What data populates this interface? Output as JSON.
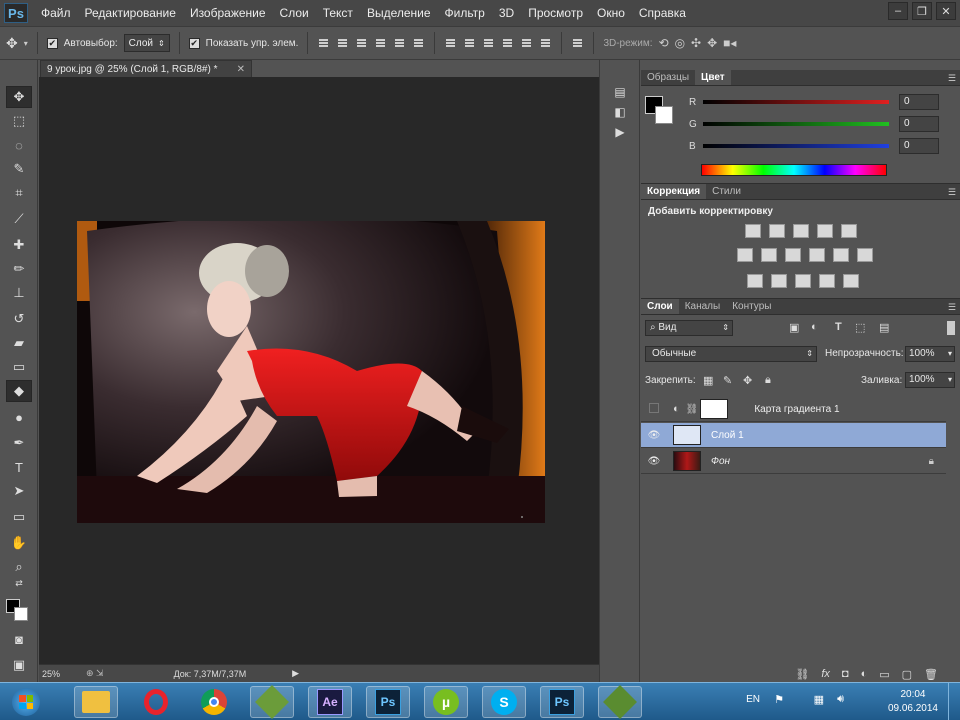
{
  "app": {
    "logo": "Ps"
  },
  "menu": [
    "Файл",
    "Редактирование",
    "Изображение",
    "Слои",
    "Текст",
    "Выделение",
    "Фильтр",
    "3D",
    "Просмотр",
    "Окно",
    "Справка"
  ],
  "options": {
    "autoselect_label": "Автовыбор:",
    "autoselect_value": "Слой",
    "show_controls_label": "Показать упр. элем.",
    "mode3d_label": "3D-режим:"
  },
  "document": {
    "tab_title": "9 урок.jpg @ 25% (Слой 1, RGB/8#) *",
    "zoom": "25%",
    "doc_size": "Док: 7,37M/7,37M"
  },
  "color_panel": {
    "tabs": [
      "Образцы",
      "Цвет"
    ],
    "active_tab": "Цвет",
    "channels": [
      {
        "label": "R",
        "value": "0",
        "color": "#e02020"
      },
      {
        "label": "G",
        "value": "0",
        "color": "#20c020"
      },
      {
        "label": "B",
        "value": "0",
        "color": "#2040e0"
      }
    ]
  },
  "adjust_panel": {
    "tabs": [
      "Коррекция",
      "Стили"
    ],
    "active_tab": "Коррекция",
    "title": "Добавить корректировку"
  },
  "layers_panel": {
    "tabs": [
      "Слои",
      "Каналы",
      "Контуры"
    ],
    "active_tab": "Слои",
    "filter": "Вид",
    "blend_mode": "Обычные",
    "opacity_label": "Непрозрачность:",
    "opacity": "100%",
    "lock_label": "Закрепить:",
    "fill_label": "Заливка:",
    "fill": "100%",
    "layers": [
      {
        "name": "Карта градиента 1",
        "visible": false,
        "selected": false
      },
      {
        "name": "Слой 1",
        "visible": true,
        "selected": true
      },
      {
        "name": "Фон",
        "visible": true,
        "selected": false,
        "locked": true
      }
    ]
  },
  "taskbar": {
    "lang": "EN",
    "time": "20:04",
    "date": "09.06.2014",
    "apps": [
      "start",
      "explorer",
      "opera",
      "chrome",
      "app-green",
      "after-effects",
      "photoshop-cs",
      "utorrent",
      "skype",
      "photoshop",
      "app-green-2"
    ]
  },
  "colors": {
    "accent": "#8fa9d6",
    "menubar": "#474747",
    "panel": "#535353"
  }
}
